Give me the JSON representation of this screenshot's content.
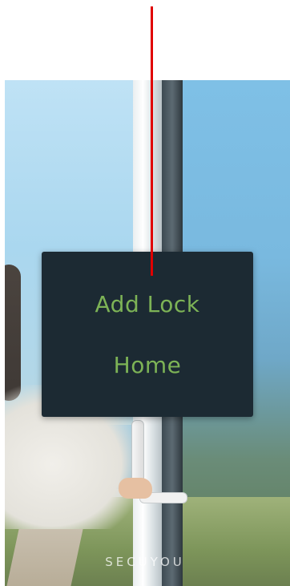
{
  "menu": {
    "items": [
      {
        "label": "Add Lock"
      },
      {
        "label": "Home"
      }
    ]
  },
  "brand": {
    "name": "SECUYOU"
  },
  "colors": {
    "menu_background": "#1c2a33",
    "menu_text": "#7db356",
    "indicator": "#e00000"
  }
}
